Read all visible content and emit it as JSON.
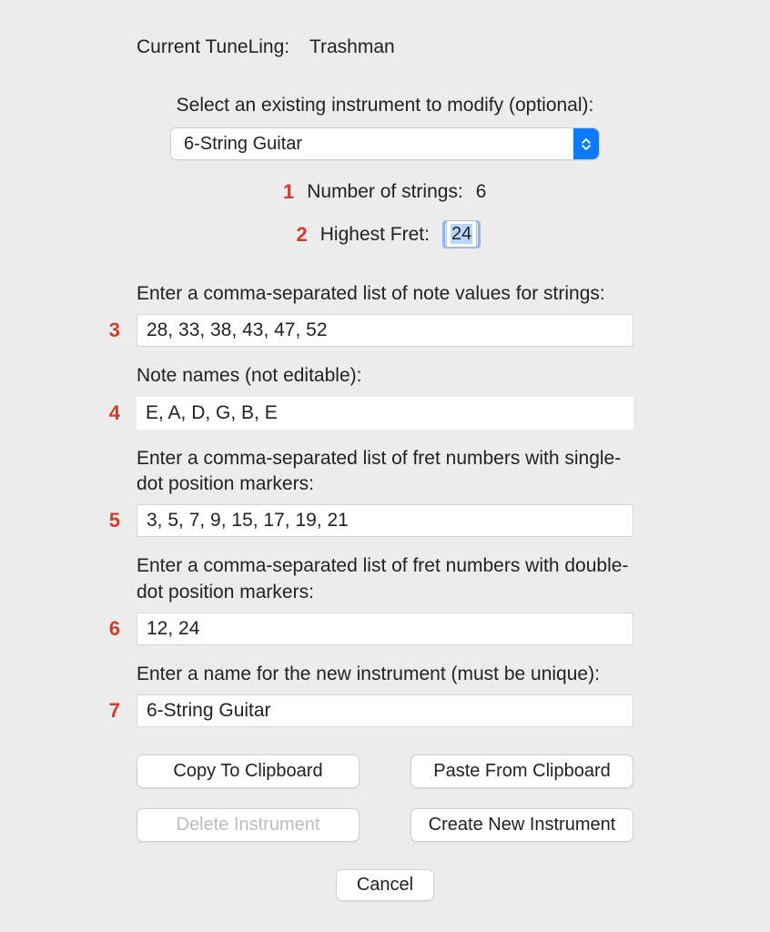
{
  "header": {
    "label": "Current TuneLing:",
    "value": "Trashman"
  },
  "selectInstrument": {
    "label": "Select an existing instrument to modify (optional):",
    "value": "6-String Guitar"
  },
  "markers": {
    "n1": "1",
    "n2": "2",
    "n3": "3",
    "n4": "4",
    "n5": "5",
    "n6": "6",
    "n7": "7"
  },
  "strings": {
    "label": "Number of strings:",
    "value": "6"
  },
  "highestFret": {
    "label": "Highest Fret:",
    "value": "24"
  },
  "noteValues": {
    "label": "Enter a comma-separated list of note values for strings:",
    "value": "28, 33, 38, 43, 47, 52"
  },
  "noteNames": {
    "label": "Note names (not editable):",
    "value": "E, A, D, G, B, E"
  },
  "singleDot": {
    "label": "Enter a comma-separated list of fret numbers with single-dot position markers:",
    "value": "3, 5, 7, 9, 15, 17, 19, 21"
  },
  "doubleDot": {
    "label": "Enter a comma-separated list of fret numbers with double-dot position markers:",
    "value": "12, 24"
  },
  "instrumentName": {
    "label": "Enter a name for the new instrument (must be unique):",
    "value": "6-String Guitar"
  },
  "buttons": {
    "copy": "Copy To Clipboard",
    "paste": "Paste From Clipboard",
    "delete": "Delete Instrument",
    "create": "Create New Instrument",
    "cancel": "Cancel"
  }
}
